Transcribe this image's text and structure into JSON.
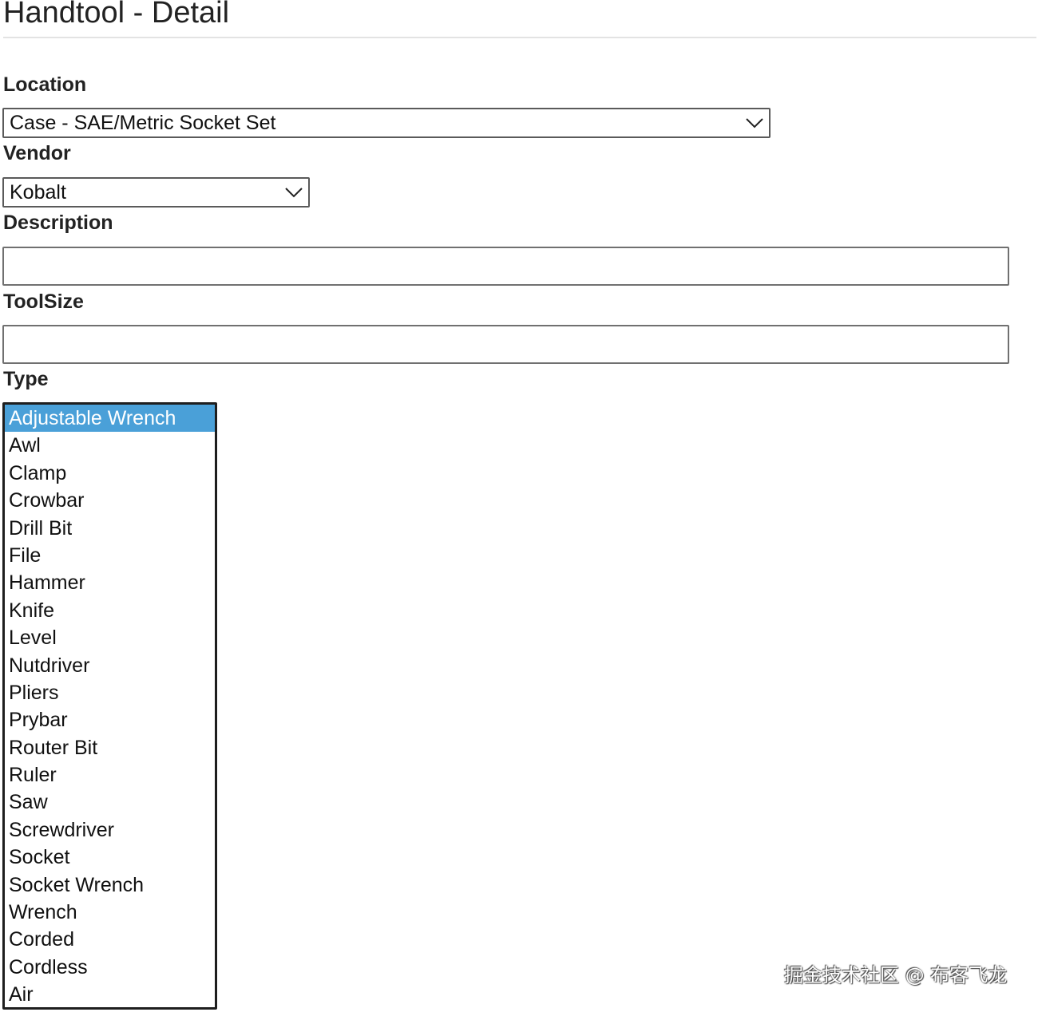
{
  "page": {
    "title": "Handtool - Detail"
  },
  "location": {
    "label": "Location",
    "selected": "Case - SAE/Metric Socket Set",
    "icon": "chevron-down-icon"
  },
  "vendor": {
    "label": "Vendor",
    "selected": "Kobalt",
    "icon": "chevron-down-icon"
  },
  "description": {
    "label": "Description",
    "value": ""
  },
  "toolsize": {
    "label": "ToolSize",
    "value": ""
  },
  "type": {
    "label": "Type",
    "selected": "Adjustable Wrench",
    "options": [
      "Adjustable Wrench",
      "Awl",
      "Clamp",
      "Crowbar",
      "Drill Bit",
      "File",
      "Hammer",
      "Knife",
      "Level",
      "Nutdriver",
      "Pliers",
      "Prybar",
      "Router Bit",
      "Ruler",
      "Saw",
      "Screwdriver",
      "Socket",
      "Socket Wrench",
      "Wrench",
      "Corded",
      "Cordless",
      "Air"
    ]
  },
  "watermark": "掘金技术社区 @ 布客飞龙",
  "colors": {
    "selected_option_bg": "#4aa0d8",
    "selected_option_text": "#ffffff",
    "text": "#222222"
  }
}
